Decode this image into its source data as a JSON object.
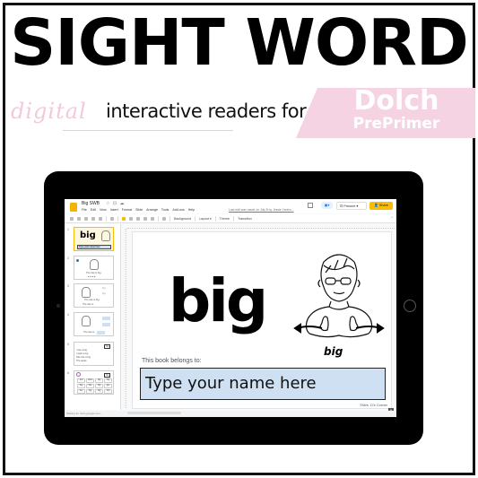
{
  "header": {
    "title": "SIGHT WORD",
    "script_word": "digital",
    "subtitle": "interactive readers for",
    "banner_title": "Dolch",
    "banner_subtitle": "PrePrimer",
    "colors": {
      "accent_pink": "#f5d3e2",
      "script_pink": "#f2c9dc"
    }
  },
  "app": {
    "doc_title": "Big SWB",
    "title_icons": "☆ ⊡ ☁",
    "menu": [
      "File",
      "Edit",
      "View",
      "Insert",
      "Format",
      "Slide",
      "Arrange",
      "Tools",
      "Add-ons",
      "Help"
    ],
    "last_edit": "Last edit was made on July 8 by Jessie Yarbro...",
    "meet_label": "▣▾",
    "present_label": "⊡ Present  ▾",
    "share_label": "👤 Share",
    "share_color": "#fbbc04",
    "toolbar": {
      "background": "Background",
      "layout": "Layout ▾",
      "theme": "Theme",
      "transition": "Transition",
      "collapse": "^"
    }
  },
  "filmstrip": {
    "slides": [
      {
        "num": "1",
        "word": "big",
        "name_placeholder": "Type your name here"
      },
      {
        "num": "2",
        "caption": "The tree is big.",
        "dots": "● ● ● ●"
      },
      {
        "num": "3",
        "caption1": "The tree is big.",
        "caption2": "The tree is",
        "choice1": "big",
        "choice2": "big"
      },
      {
        "num": "4",
        "caption": "The tree is"
      },
      {
        "num": "5",
        "rows": [
          "I see a  big",
          "I want a  big",
          "She has a  big",
          "The apple"
        ],
        "header": "big"
      },
      {
        "num": "6",
        "header": "big",
        "grid": [
          "but",
          "drive",
          "big",
          "big",
          "big",
          "like",
          "big",
          "get",
          "the",
          "big",
          "big",
          "but"
        ]
      }
    ]
  },
  "slide": {
    "word": "big",
    "asl_label": "big",
    "belongs_label": "This book belongs to:",
    "name_field_value": "Type your name here",
    "copyright": "©Mrs. D's Corner"
  },
  "status": {
    "text": "Waiting for docs.google.com..."
  }
}
